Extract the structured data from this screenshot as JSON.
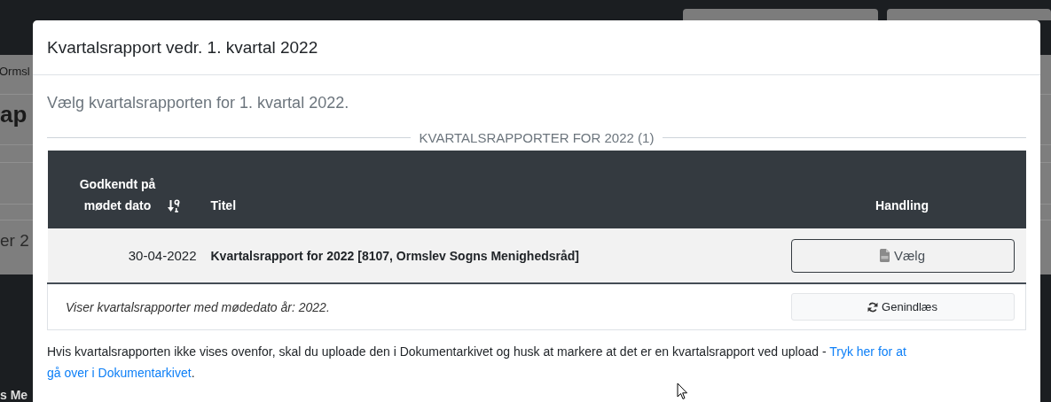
{
  "background": {
    "fragments": [
      {
        "text": "Ormsl",
        "kind": "plain"
      },
      {
        "text": "ap",
        "kind": "heading"
      },
      {
        "text": "er 2",
        "kind": "large"
      },
      {
        "text": "s Me",
        "kind": "bold"
      }
    ]
  },
  "modal": {
    "title": "Kvartalsrapport vedr. 1. kvartal 2022",
    "intro": "Vælg kvartalsrapporten for 1. kvartal 2022.",
    "section_heading": "KVARTALSRAPPORTER FOR 2022 (1)",
    "table": {
      "columns": [
        {
          "label": "Godkendt på mødet dato",
          "sorted": true
        },
        {
          "label": "Titel",
          "sorted": false
        },
        {
          "label": "Handling",
          "sorted": false
        }
      ],
      "rows": [
        {
          "date": "30-04-2022",
          "title": "Kvartalsrapport for 2022 [8107, Ormslev Sogns Menighedsråd]",
          "action": "Vælg"
        }
      ],
      "footer": {
        "note": "Viser kvartalsrapporter med mødedato år: 2022.",
        "button": "Genindlæs"
      }
    },
    "help": {
      "text": "Hvis kvartalsrapporten ikke vises ovenfor, skal du uploade den i Dokumentarkivet og husk at markere at det er en kvartalsrapport ved upload - ",
      "link_lines": [
        "Tryk her for at",
        "gå over i Dokumentarkivet"
      ],
      "end": "."
    }
  }
}
